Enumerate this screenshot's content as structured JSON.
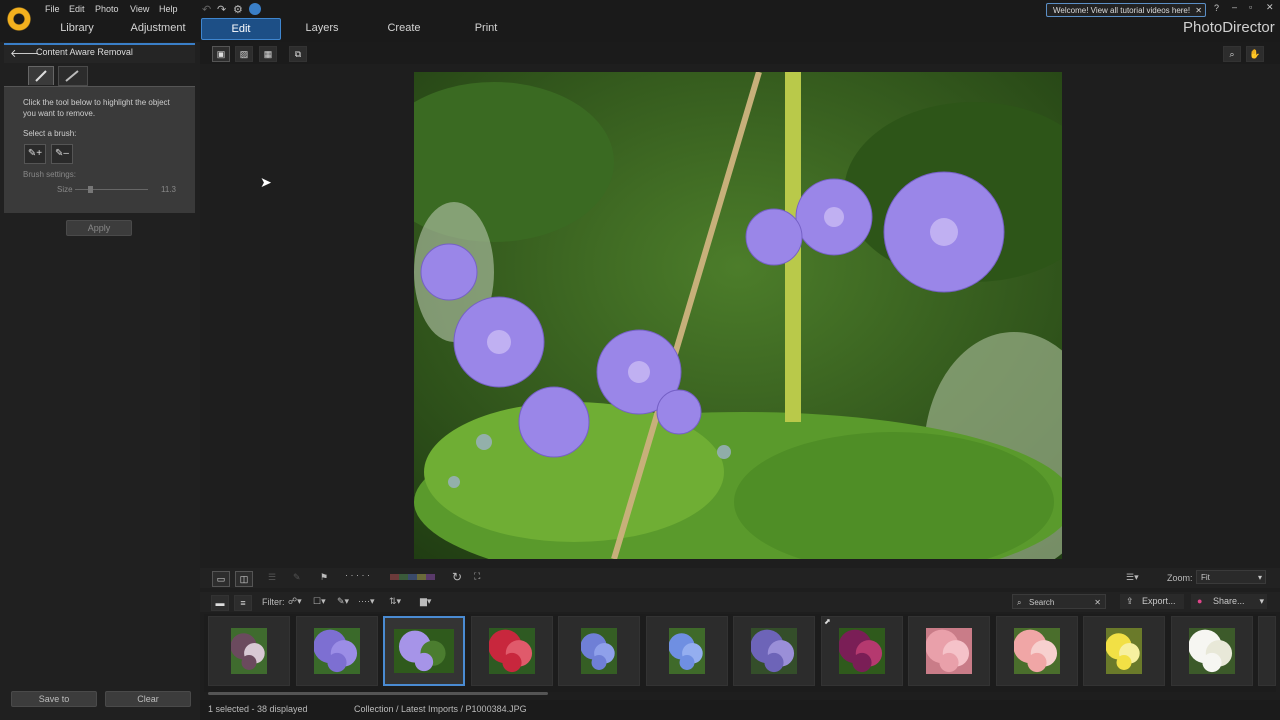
{
  "menu": [
    "File",
    "Edit",
    "Photo",
    "View",
    "Help"
  ],
  "nav_tabs": [
    "Library",
    "Adjustment",
    "Edit",
    "Layers",
    "Create",
    "Print"
  ],
  "active_tab": "Edit",
  "welcome_banner": "Welcome! View all tutorial videos here!",
  "brand": "PhotoDirector",
  "window_controls": {
    "help": "?",
    "minimize": "–",
    "restore": "▫",
    "close": "✕"
  },
  "left_panel": {
    "title": "Content Aware Removal",
    "instruction": "Click the tool below to highlight the object you want to remove.",
    "select_brush": "Select a brush:",
    "brush_settings": "Brush settings:",
    "size_label": "Size",
    "size_value": "11.3",
    "size_fraction": 0.2,
    "apply": "Apply",
    "save_to": "Save to",
    "clear": "Clear"
  },
  "toolbar2": {
    "zoom_label": "Zoom:",
    "zoom_value": "Fit",
    "filter_label": "Filter:",
    "search_placeholder": "Search",
    "export": "Export...",
    "share": "Share..."
  },
  "thumbnails": [
    {
      "colors": [
        "#6b4a5e",
        "#d8c8d4",
        "#3f6b2e"
      ],
      "shape": "tall"
    },
    {
      "colors": [
        "#7d6fd2",
        "#9b8de6",
        "#3a6a2a"
      ],
      "shape": "round"
    },
    {
      "colors": [
        "#a694e8",
        "#4b7d2f",
        "#2f5a1c"
      ],
      "shape": "landscape",
      "selected": true
    },
    {
      "colors": [
        "#c8273d",
        "#e05a6b",
        "#2e5a22"
      ],
      "shape": "round"
    },
    {
      "colors": [
        "#6f7fd6",
        "#8fa0ea",
        "#355e24"
      ],
      "shape": "tall"
    },
    {
      "colors": [
        "#6f8fe2",
        "#94aef0",
        "#3f6a2a"
      ],
      "shape": "tall"
    },
    {
      "colors": [
        "#6d64b8",
        "#9a8fd8",
        "#344e2a"
      ],
      "shape": "round"
    },
    {
      "colors": [
        "#7a1e56",
        "#b5396f",
        "#2f5a1c"
      ],
      "shape": "round"
    },
    {
      "colors": [
        "#e9a0aa",
        "#f5c2c9",
        "#c97c88"
      ],
      "shape": "round"
    },
    {
      "colors": [
        "#f0a6a6",
        "#f7d0cf",
        "#4a6e2c"
      ],
      "shape": "round"
    },
    {
      "colors": [
        "#f2e045",
        "#f7f0a0",
        "#6a7a2a"
      ],
      "shape": "tall"
    },
    {
      "colors": [
        "#f6f6f2",
        "#e8e8d8",
        "#3c5a2a"
      ],
      "shape": "round"
    }
  ],
  "status": {
    "selection": "1 selected - 38 displayed",
    "path": "Collection / Latest Imports / P1000384.JPG"
  },
  "colors": {
    "accent": "#3a7fc8",
    "active_tab": "#1d4f86",
    "selected_thumb": "#4a8bd2"
  }
}
